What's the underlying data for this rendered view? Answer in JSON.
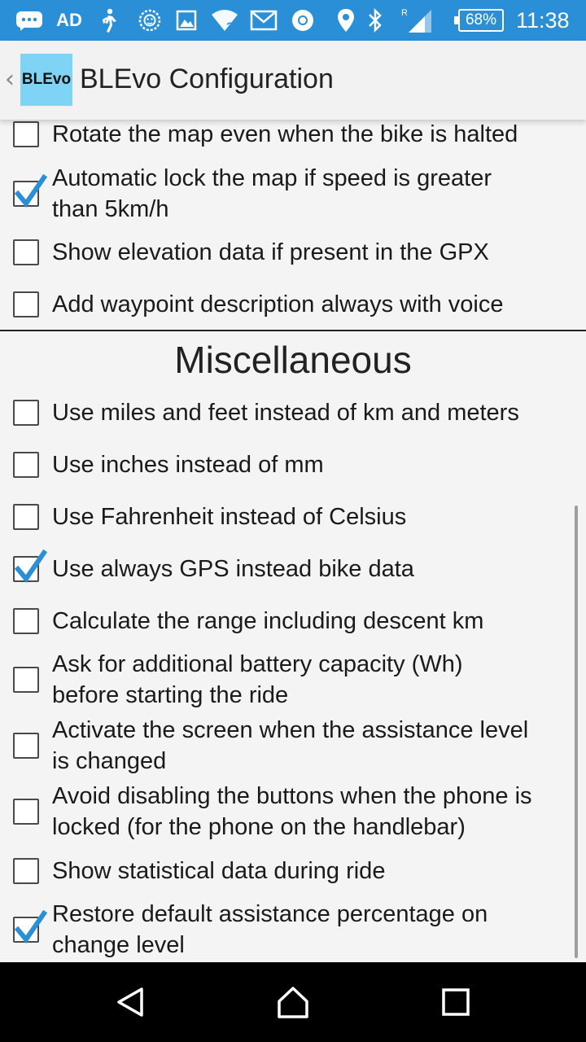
{
  "status_bar": {
    "icons": [
      "chat-icon",
      "ad-icon",
      "walk-icon",
      "lion-icon",
      "image-icon",
      "wifi-unknown-icon",
      "gmail-icon",
      "chrome-icon",
      "location-icon",
      "bluetooth-icon",
      "signal-roaming-icon"
    ],
    "ad_text": "AD",
    "roaming_text": "R",
    "battery": "68%",
    "time": "11:38",
    "background": "#2b8fd8"
  },
  "action_bar": {
    "logo_text": "BLEvo",
    "title": "BLEvo Configuration",
    "logo_color": "#7fd3f5"
  },
  "map_options": [
    {
      "label_lines": [
        "Rotate the map even when the bike is halted"
      ],
      "checked": false
    },
    {
      "label_lines": [
        "Automatic lock the map if speed is greater",
        "than 5km/h"
      ],
      "checked": true
    },
    {
      "label_lines": [
        "Show elevation data if present in the GPX"
      ],
      "checked": false
    },
    {
      "label_lines": [
        "Add waypoint description always with voice"
      ],
      "checked": false
    }
  ],
  "misc_section": {
    "title": "Miscellaneous",
    "options": [
      {
        "label_lines": [
          "Use miles and feet instead of km and meters"
        ],
        "checked": false
      },
      {
        "label_lines": [
          "Use inches instead of mm"
        ],
        "checked": false
      },
      {
        "label_lines": [
          "Use Fahrenheit instead of Celsius"
        ],
        "checked": false
      },
      {
        "label_lines": [
          "Use always GPS instead bike data"
        ],
        "checked": true
      },
      {
        "label_lines": [
          "Calculate the range including descent km"
        ],
        "checked": false
      },
      {
        "label_lines": [
          "Ask for additional battery capacity (Wh)",
          "before starting the ride"
        ],
        "checked": false
      },
      {
        "label_lines": [
          "Activate the screen when the assistance level",
          "is changed"
        ],
        "checked": false
      },
      {
        "label_lines": [
          "Avoid disabling the buttons when the phone is",
          "locked (for the phone on the handlebar)"
        ],
        "checked": false
      },
      {
        "label_lines": [
          "Show statistical data during ride"
        ],
        "checked": false
      },
      {
        "label_lines": [
          "Restore default assistance percentage on",
          "change level"
        ],
        "checked": true
      }
    ]
  },
  "nav_bar": {
    "buttons": [
      "back-icon",
      "home-icon",
      "recents-icon"
    ]
  },
  "colors": {
    "checkmark": "#2b8fd8",
    "text": "#1a1a1a"
  }
}
